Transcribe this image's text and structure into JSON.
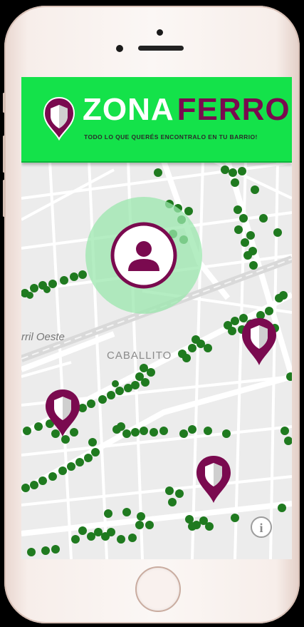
{
  "app": {
    "brand_first": "ZONA",
    "brand_second": "FERRO",
    "tagline": "TODO LO QUE QUERÉS ENCONTRALO EN TU BARRIO!"
  },
  "map": {
    "labels": {
      "neighborhood": "CABALLITO",
      "partial_station": "rril Oeste"
    },
    "info_button": "i",
    "markers": [
      "shield-pin",
      "shield-pin",
      "shield-pin"
    ],
    "user_location": "user-location"
  },
  "colors": {
    "header_green": "#14e24a",
    "brand_purple": "#7a0a4f",
    "tree_green": "#1f7a1f",
    "location_halo": "#9be7ad"
  }
}
